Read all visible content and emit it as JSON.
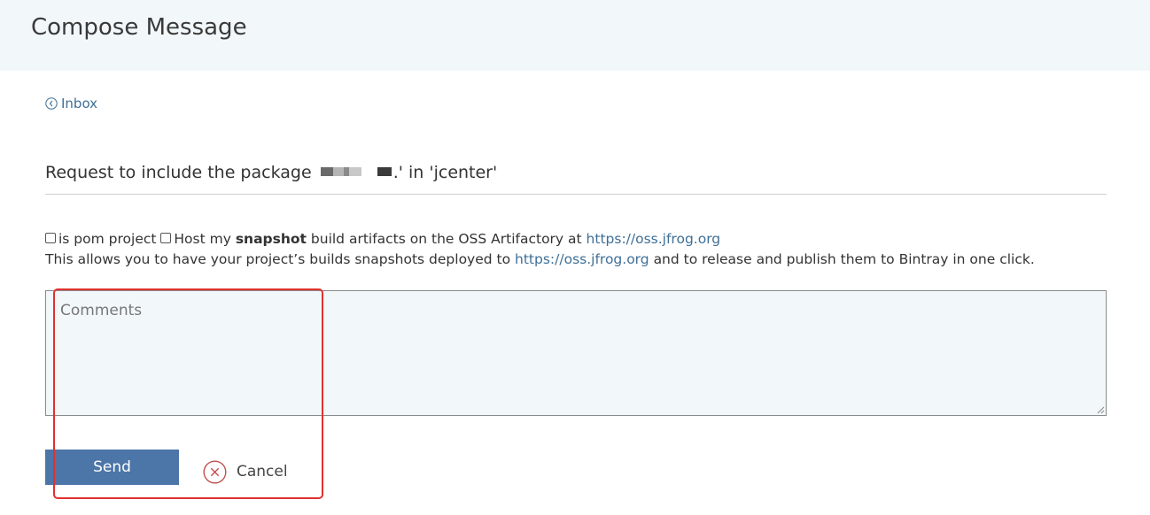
{
  "header": {
    "title": "Compose Message"
  },
  "nav": {
    "back_label": "Inbox"
  },
  "subject": {
    "prefix": "Request to include the package",
    "suffix": ".' in 'jcenter'"
  },
  "options": {
    "pom_label": "is pom project",
    "snapshot_pre": "Host my",
    "snapshot_bold": "snapshot",
    "snapshot_post": "build artifacts on the OSS Artifactory at",
    "snapshot_link": "https://oss.jfrog.org",
    "info_pre": "This allows you to have your project’s builds snapshots deployed to",
    "info_link": "https://oss.jfrog.org",
    "info_post": "and to release and publish them to Bintray in one click."
  },
  "comments": {
    "placeholder": "Comments",
    "value": ""
  },
  "actions": {
    "send_label": "Send",
    "cancel_label": "Cancel"
  },
  "colors": {
    "header_bg": "#f2f8fa",
    "link": "#3f6f97",
    "send_button": "#4c75a8",
    "cancel_icon": "#c0504d",
    "annotation": "#e0312f"
  },
  "icons": {
    "back": "chevron-left-circle-icon",
    "cancel": "x-circle-icon"
  }
}
